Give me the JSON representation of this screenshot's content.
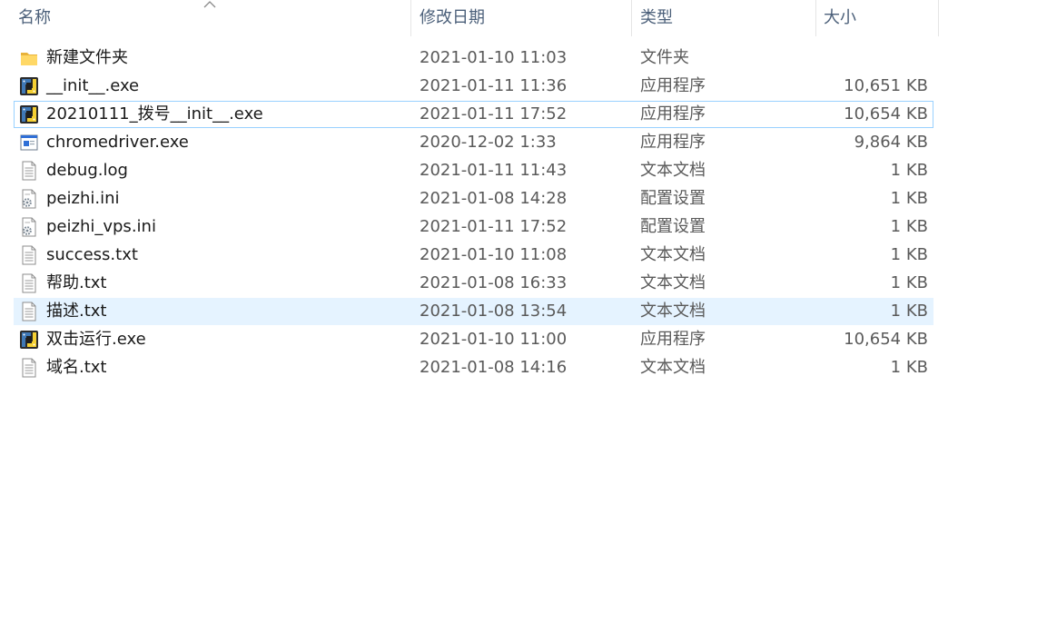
{
  "columns": {
    "name": "名称",
    "date": "修改日期",
    "type": "类型",
    "size": "大小"
  },
  "files": [
    {
      "name": "新建文件夹",
      "date": "2021-01-10 11:03",
      "type": "文件夹",
      "size": "",
      "icon": "folder-icon"
    },
    {
      "name": "__init__.exe",
      "date": "2021-01-11 11:36",
      "type": "应用程序",
      "size": "10,651 KB",
      "icon": "python-exe-icon"
    },
    {
      "name": "20210111_拨号__init__.exe",
      "date": "2021-01-11 17:52",
      "type": "应用程序",
      "size": "10,654 KB",
      "icon": "python-exe-icon"
    },
    {
      "name": "chromedriver.exe",
      "date": "2020-12-02 1:33",
      "type": "应用程序",
      "size": "9,864 KB",
      "icon": "app-window-icon"
    },
    {
      "name": "debug.log",
      "date": "2021-01-11 11:43",
      "type": "文本文档",
      "size": "1 KB",
      "icon": "text-file-icon"
    },
    {
      "name": "peizhi.ini",
      "date": "2021-01-08 14:28",
      "type": "配置设置",
      "size": "1 KB",
      "icon": "config-file-icon"
    },
    {
      "name": "peizhi_vps.ini",
      "date": "2021-01-11 17:52",
      "type": "配置设置",
      "size": "1 KB",
      "icon": "config-file-icon"
    },
    {
      "name": "success.txt",
      "date": "2021-01-10 11:08",
      "type": "文本文档",
      "size": "1 KB",
      "icon": "text-file-icon"
    },
    {
      "name": "帮助.txt",
      "date": "2021-01-08 16:33",
      "type": "文本文档",
      "size": "1 KB",
      "icon": "text-file-icon"
    },
    {
      "name": "描述.txt",
      "date": "2021-01-08 13:54",
      "type": "文本文档",
      "size": "1 KB",
      "icon": "text-file-icon"
    },
    {
      "name": "双击运行.exe",
      "date": "2021-01-10 11:00",
      "type": "应用程序",
      "size": "10,654 KB",
      "icon": "python-exe-icon"
    },
    {
      "name": "域名.txt",
      "date": "2021-01-08 14:16",
      "type": "文本文档",
      "size": "1 KB",
      "icon": "text-file-icon"
    }
  ],
  "colors": {
    "header_text": "#4c607a",
    "hover_bg": "#e5f3ff",
    "focus_border": "#99d1ff"
  }
}
